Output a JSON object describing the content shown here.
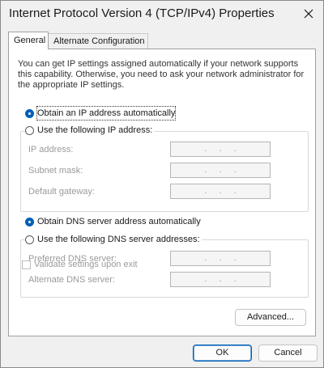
{
  "window": {
    "title": "Internet Protocol Version 4 (TCP/IPv4) Properties"
  },
  "tabs": [
    {
      "label": "General"
    },
    {
      "label": "Alternate Configuration"
    }
  ],
  "intro": "You can get IP settings assigned automatically if your network supports this capability. Otherwise, you need to ask your network administrator for the appropriate IP settings.",
  "ip_section": {
    "auto_label": "Obtain an IP address automatically",
    "manual_label": "Use the following IP address:",
    "auto_selected": true,
    "fields": [
      {
        "label": "IP address:",
        "value": ". . ."
      },
      {
        "label": "Subnet mask:",
        "value": ". . ."
      },
      {
        "label": "Default gateway:",
        "value": ". . ."
      }
    ]
  },
  "dns_section": {
    "auto_label": "Obtain DNS server address automatically",
    "manual_label": "Use the following DNS server addresses:",
    "auto_selected": true,
    "fields": [
      {
        "label": "Preferred DNS server:",
        "value": ". . ."
      },
      {
        "label": "Alternate DNS server:",
        "value": ". . ."
      }
    ]
  },
  "validate_label": "Validate settings upon exit",
  "advanced_label": "Advanced...",
  "ok_label": "OK",
  "cancel_label": "Cancel",
  "colors": {
    "accent": "#005fb8",
    "disabled_text": "#9a9a9a"
  },
  "icons": {
    "close": "close-icon"
  }
}
